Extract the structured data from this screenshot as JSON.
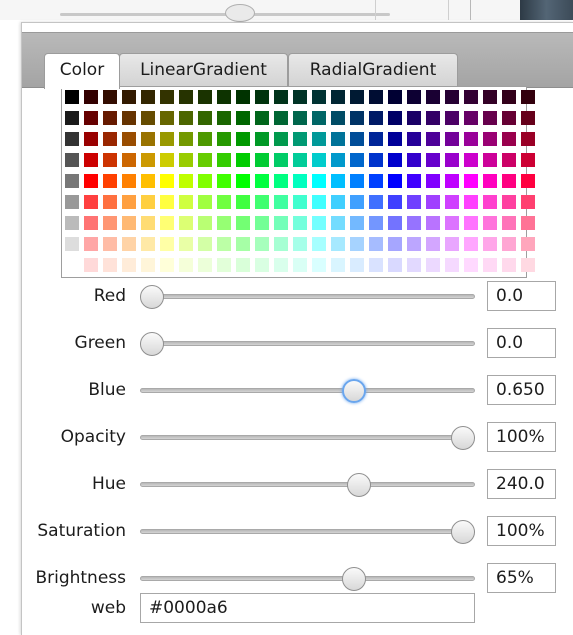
{
  "tabs": [
    {
      "label": "Color",
      "active": true
    },
    {
      "label": "LinearGradient",
      "active": false
    },
    {
      "label": "RadialGradient",
      "active": false
    }
  ],
  "sliders": [
    {
      "name": "red",
      "label": "Red",
      "value": "0.0",
      "level": 0.0,
      "focused": false
    },
    {
      "name": "green",
      "label": "Green",
      "value": "0.0",
      "level": 0.0,
      "focused": false
    },
    {
      "name": "blue",
      "label": "Blue",
      "value": "0.650",
      "level": 0.65,
      "focused": true
    },
    {
      "name": "opacity",
      "label": "Opacity",
      "value": "100%",
      "level": 1.0,
      "focused": false
    },
    {
      "name": "hue",
      "label": "Hue",
      "value": "240.0",
      "level": 0.667,
      "focused": false
    },
    {
      "name": "saturation",
      "label": "Saturation",
      "value": "100%",
      "level": 1.0,
      "focused": false
    },
    {
      "name": "brightness",
      "label": "Brightness",
      "value": "65%",
      "level": 0.65,
      "focused": false
    }
  ],
  "web": {
    "label": "web",
    "value": "#0000a6"
  },
  "palette": {
    "hues": [
      "#ff0000",
      "#ff4000",
      "#ff8000",
      "#ffbf00",
      "#ffff00",
      "#bfff00",
      "#80ff00",
      "#40ff00",
      "#00ff00",
      "#00ff40",
      "#00ff80",
      "#00ffbf",
      "#00ffff",
      "#00bfff",
      "#0080ff",
      "#0040ff",
      "#0000ff",
      "#4000ff",
      "#8000ff",
      "#bf00ff",
      "#ff00ff",
      "#ff00bf",
      "#ff0080",
      "#ff0040"
    ],
    "grays": [
      "#000000",
      "#1a1a1a",
      "#333333",
      "#555555",
      "#777777",
      "#999999",
      "#bbbbbb",
      "#dddddd",
      "#ffffff"
    ]
  }
}
